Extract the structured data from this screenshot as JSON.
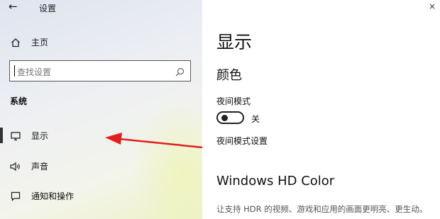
{
  "window": {
    "title": "设置",
    "close_glyph": "×"
  },
  "sidebar": {
    "back_icon": "back-arrow-icon",
    "home": {
      "label": "主页",
      "icon": "home-icon"
    },
    "search": {
      "placeholder": "查找设置",
      "icon": "search-icon"
    },
    "section_title": "系统",
    "items": [
      {
        "label": "显示",
        "icon": "monitor-icon",
        "selected": true
      },
      {
        "label": "声音",
        "icon": "speaker-icon",
        "selected": false
      },
      {
        "label": "通知和操作",
        "icon": "notification-icon",
        "selected": false
      }
    ]
  },
  "main": {
    "page_title": "显示",
    "color_section": "颜色",
    "night_mode_label": "夜间模式",
    "night_mode_state": "关",
    "night_mode_on": false,
    "night_mode_settings_link": "夜间模式设置",
    "hdr_section": "Windows HD Color",
    "hdr_description": "让支持 HDR 的视频、游戏和应用的画面更明亮、更生动。"
  },
  "annotation": {
    "arrow_color": "#e02020"
  }
}
